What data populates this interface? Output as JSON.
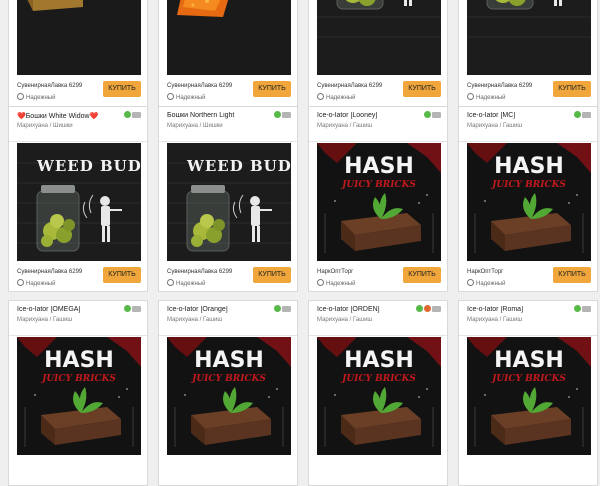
{
  "colors": {
    "accent": "#f0a63b",
    "ok": "#57b947",
    "fav": "#e0692f"
  },
  "images": {
    "weed": {
      "headline": "WEED BUDS"
    },
    "hash": {
      "headline": "HASH",
      "sub": "JUICY BRICKS"
    }
  },
  "rows": [
    {
      "cards": [
        {
          "image": "wall-hash-block",
          "seller": "СувенирнаяЛавка 6299",
          "trust": "Надежный",
          "buy": "КУПИТЬ"
        },
        {
          "image": "wall-orange-hash",
          "seller": "СувенирнаяЛавка 6299",
          "trust": "Надежный",
          "buy": "КУПИТЬ"
        },
        {
          "image": "weed-jar",
          "seller": "СувенирнаяЛавка 6299",
          "trust": "Надежный",
          "buy": "КУПИТЬ"
        },
        {
          "image": "weed-jar",
          "seller": "СувенирнаяЛавка 6299",
          "trust": "Надежный",
          "buy": "КУПИТЬ"
        }
      ]
    },
    {
      "cards": [
        {
          "title": "❤️Бошки White Widow❤️",
          "category": "Марихуана / Шишки",
          "image": "weed-buds",
          "seller": "СувенирнаяЛавка 6299",
          "trust": "Надежный",
          "buy": "КУПИТЬ",
          "badges": [
            "ok",
            "mail"
          ]
        },
        {
          "title": "Бошки Northern Light",
          "category": "Марихуана / Шишки",
          "image": "weed-buds",
          "seller": "СувенирнаяЛавка 6299",
          "trust": "Надежный",
          "buy": "КУПИТЬ",
          "badges": [
            "ok",
            "mail"
          ]
        },
        {
          "title": "Ice-o-lator [Looney]",
          "category": "Марихуана / Гашиш",
          "image": "hash-juicy",
          "seller": "НаркОптТорг",
          "trust": "Надежный",
          "buy": "КУПИТЬ",
          "badges": [
            "ok",
            "mail"
          ]
        },
        {
          "title": "Ice-o-lator [MC]",
          "category": "Марихуана / Гашиш",
          "image": "hash-juicy",
          "seller": "НаркОптТорг",
          "trust": "Надежный",
          "buy": "КУПИТЬ",
          "badges": [
            "ok",
            "mail"
          ]
        }
      ]
    },
    {
      "cards": [
        {
          "title": "Ice-o-lator [OMEGA]",
          "category": "Марихуана / Гашиш",
          "image": "hash-juicy",
          "badges": [
            "ok",
            "mail"
          ]
        },
        {
          "title": "Ice-o-lator [Orange]",
          "category": "Марихуана / Гашиш",
          "image": "hash-juicy",
          "badges": [
            "ok",
            "mail"
          ]
        },
        {
          "title": "Ice-o-lator [ORDEN]",
          "category": "Марихуана / Гашиш",
          "image": "hash-juicy",
          "badges": [
            "ok",
            "fav",
            "mail"
          ]
        },
        {
          "title": "Ice-o-lator [Roma]",
          "category": "Марихуана / Гашиш",
          "image": "hash-juicy",
          "badges": [
            "ok",
            "mail"
          ]
        }
      ]
    }
  ]
}
